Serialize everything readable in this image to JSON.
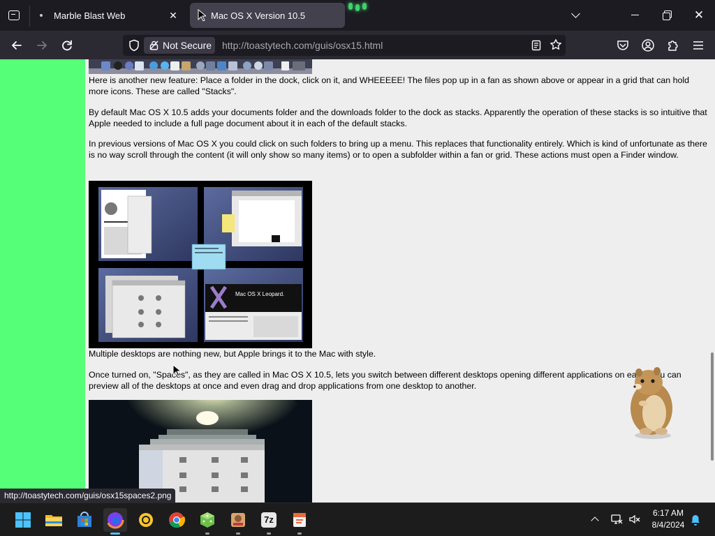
{
  "browser": {
    "tabs": [
      {
        "title": "Marble Blast Web",
        "active": false
      },
      {
        "title": "Mac OS X Version 10.5",
        "active": true
      }
    ],
    "security_label": "Not Secure",
    "url": "http://toastytech.com/guis/osx15.html",
    "status_url": "http://toastytech.com/guis/osx15spaces2.png"
  },
  "page": {
    "paragraphs": {
      "stacks": "Here is another new feature: Place a folder in the dock, click on it, and WHEEEEE! The files pop up in a fan as shown above or appear in a grid that can hold more icons. These are called \"Stacks\".",
      "default_stacks": "By default Mac OS X 10.5 adds your documents folder and the downloads folder to the dock as stacks. Apparently the operation of these stacks is so intuitive that Apple needed to include a full page document about it in each of the default stacks.",
      "previous_versions": "In previous versions of Mac OS X you could click on such folders to bring up a menu. This replaces that functionality entirely. Which is kind of unfortunate as there is no way scroll through the content (it will only show so many items) or to open a subfolder within a fan or grid. These actions must open a Finder window.",
      "multiple_desktops": "Multiple desktops are nothing new, but Apple brings it to the Mac with style.",
      "spaces": "Once turned on, \"Spaces\", as they are called in Mac OS X 10.5, lets you switch between different desktops opening different applications on each. You can preview all of the desktops at once and even drag and drop applications from one desktop to another."
    },
    "screenshot_text": {
      "leopard_banner": "Mac OS X Leopard."
    },
    "sidebar_color": "#55ff77",
    "background_color": "#eeeeee"
  },
  "taskbar": {
    "apps": [
      "start-icon",
      "file-explorer-icon",
      "store-icon",
      "firefox-icon",
      "norton-icon",
      "chrome-icon",
      "dice-game-icon",
      "game-icon",
      "7zip-icon",
      "presentation-icon"
    ],
    "seven_zip_label": "7z",
    "clock": {
      "time": "6:17 AM",
      "date": "8/4/2024"
    }
  },
  "colors": {
    "accent": "#4cc2ff",
    "tab_active": "#42414d",
    "toolbar": "#2b2a33"
  }
}
